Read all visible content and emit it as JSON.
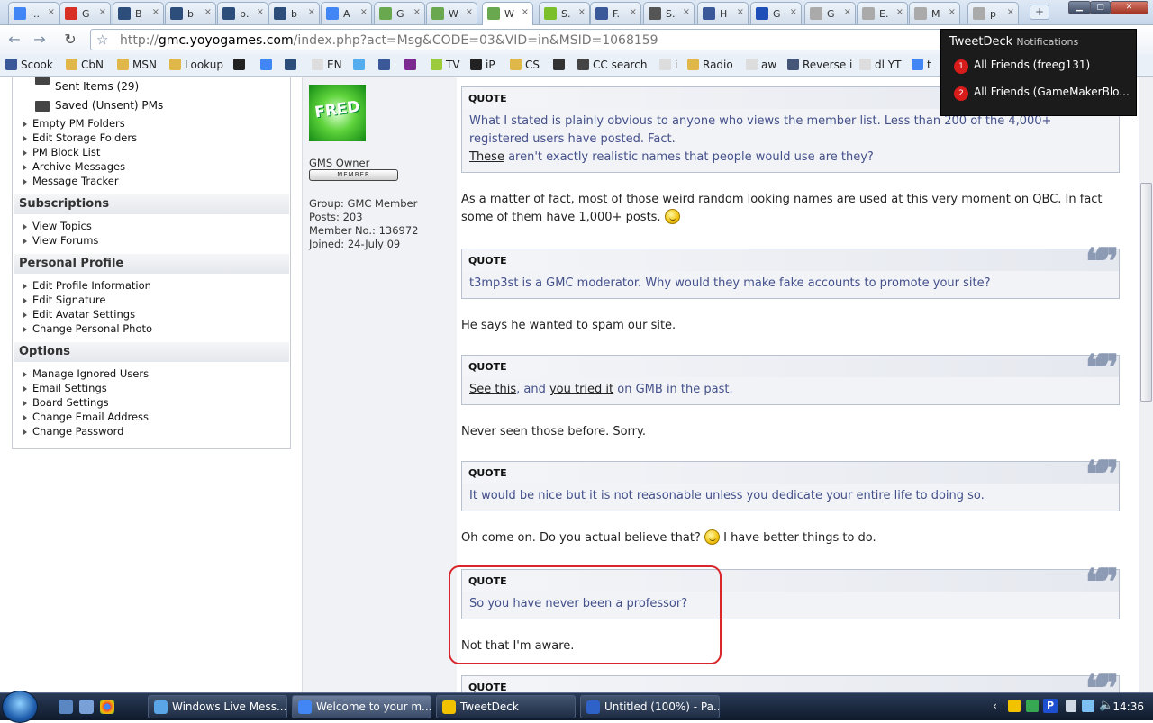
{
  "browser": {
    "tabs": [
      {
        "label": "i..",
        "icon": "google-icon",
        "color": "#4285f4"
      },
      {
        "label": "G",
        "icon": "gmail-icon",
        "color": "#d93025"
      },
      {
        "label": "B",
        "icon": "gm-icon",
        "color": "#2d4e7a"
      },
      {
        "label": "b",
        "icon": "gm-icon",
        "color": "#2d4e7a"
      },
      {
        "label": "b.",
        "icon": "gm-icon",
        "color": "#2d4e7a"
      },
      {
        "label": "b",
        "icon": "gm-icon",
        "color": "#2d4e7a"
      },
      {
        "label": "A",
        "icon": "google-icon",
        "color": "#4285f4"
      },
      {
        "label": "G",
        "icon": "check-icon",
        "color": "#6aa84f"
      },
      {
        "label": "W",
        "icon": "check-icon",
        "color": "#6aa84f"
      },
      {
        "label": "W",
        "icon": "check-icon",
        "color": "#6aa84f",
        "active": true
      },
      {
        "label": "S.",
        "icon": "t-icon",
        "color": "#7bbf2a"
      },
      {
        "label": "F.",
        "icon": "facebook-icon",
        "color": "#3b5998"
      },
      {
        "label": "S.",
        "icon": "wikipedia-icon",
        "color": "#555555"
      },
      {
        "label": "H",
        "icon": "clock-icon",
        "color": "#3b5998"
      },
      {
        "label": "G",
        "icon": "pacman-icon",
        "color": "#1e4fb8"
      },
      {
        "label": "G",
        "icon": "page-icon",
        "color": "#aaaaaa"
      },
      {
        "label": "E.",
        "icon": "page-icon",
        "color": "#aaaaaa"
      },
      {
        "label": "M",
        "icon": "page-icon",
        "color": "#aaaaaa"
      },
      {
        "label": "p",
        "icon": "page-icon",
        "color": "#aaaaaa"
      }
    ],
    "url_prefix": "http://",
    "url_host": "gmc.yoyogames.com",
    "url_path": "/index.php?act=Msg&CODE=03&VID=in&MSID=1068159"
  },
  "bookmarks": [
    {
      "label": "Scook",
      "color": "#3b5998"
    },
    {
      "label": "CbN",
      "color": "#e0b84a"
    },
    {
      "label": "MSN",
      "color": "#e0b84a"
    },
    {
      "label": "Lookup",
      "color": "#e0b84a"
    },
    {
      "label": "",
      "color": "#222222"
    },
    {
      "label": "",
      "color": "#4285f4"
    },
    {
      "label": "",
      "color": "#2d4e7a"
    },
    {
      "label": "EN",
      "color": "#dddddd"
    },
    {
      "label": "",
      "color": "#55acee"
    },
    {
      "label": "",
      "color": "#3b5998"
    },
    {
      "label": "",
      "color": "#7b2b8f"
    },
    {
      "label": "TV",
      "color": "#9bcb3c"
    },
    {
      "label": "iP",
      "color": "#222222"
    },
    {
      "label": "CS",
      "color": "#e0b84a"
    },
    {
      "label": "",
      "color": "#333333"
    },
    {
      "label": "CC search",
      "color": "#444444"
    },
    {
      "label": "i",
      "color": "#dddddd"
    },
    {
      "label": "Radio",
      "color": "#e0b84a"
    },
    {
      "label": "aw",
      "color": "#dddddd"
    },
    {
      "label": "Reverse i",
      "color": "#445577"
    },
    {
      "label": "dl YT",
      "color": "#dddddd"
    },
    {
      "label": "t",
      "color": "#4285f4"
    }
  ],
  "sidebar": {
    "folders": [
      "Sent Items (29)",
      "Saved (Unsent) PMs"
    ],
    "folder_links": [
      "Empty PM Folders",
      "Edit Storage Folders",
      "PM Block List",
      "Archive Messages",
      "Message Tracker"
    ],
    "subscriptions": {
      "title": "Subscriptions",
      "items": [
        "View Topics",
        "View Forums"
      ]
    },
    "profile": {
      "title": "Personal Profile",
      "items": [
        "Edit Profile Information",
        "Edit Signature",
        "Edit Avatar Settings",
        "Change Personal Photo"
      ]
    },
    "options": {
      "title": "Options",
      "items": [
        "Manage Ignored Users",
        "Email Settings",
        "Board Settings",
        "Change Email Address",
        "Change Password"
      ]
    }
  },
  "member": {
    "avatar_text": "FRED",
    "title": "GMS Owner",
    "badge": "MEMBER",
    "group": "Group: GMC Member",
    "posts": "Posts: 203",
    "member_no": "Member No.: 136972",
    "joined": "Joined: 24-July 09"
  },
  "post": {
    "quote_label": "QUOTE",
    "quote1_line1": "What I stated is plainly obvious to anyone who views the member list. Less than 200 of the 4,000+",
    "quote1_line2": "registered users have posted. Fact.",
    "quote1_link": "These",
    "quote1_line3": " aren't exactly realistic names that people would use are they?",
    "reply1": "As a matter of fact, most of those weird random looking names are used at this very moment on QBC. In fact some of them have 1,000+ posts.",
    "quote2": "t3mp3st is a GMC moderator. Why would they make fake accounts to promote your site?",
    "reply2": "He says he wanted to spam our site.",
    "quote3_link1": "See this",
    "quote3_mid": ", and ",
    "quote3_link2": "you tried it",
    "quote3_end": " on GMB in the past.",
    "reply3": "Never seen those before. Sorry.",
    "quote4": "It would be nice but it is not reasonable unless you dedicate your entire life to doing so.",
    "reply4a": "Oh come on. Do you actual believe that?",
    "reply4b": " I have better things to do.",
    "quote5": "So you have never been a professor?",
    "reply5": "Not that I'm aware."
  },
  "notification": {
    "app": "TweetDeck",
    "subtitle": "Notifications",
    "rows": [
      {
        "num": "1",
        "label": "All Friends (freeg131)"
      },
      {
        "num": "2",
        "label": "All Friends (GameMakerBlo..."
      }
    ]
  },
  "taskbar": {
    "buttons": [
      {
        "label": "Windows Live Mess...",
        "color": "#5aa5e6"
      },
      {
        "label": "Welcome to your m...",
        "color": "#4285f4",
        "active": true
      },
      {
        "label": "TweetDeck",
        "color": "#f2c200"
      },
      {
        "label": "Untitled (100%) - Pa...",
        "color": "#2e62c8"
      }
    ],
    "time": "14:36"
  }
}
